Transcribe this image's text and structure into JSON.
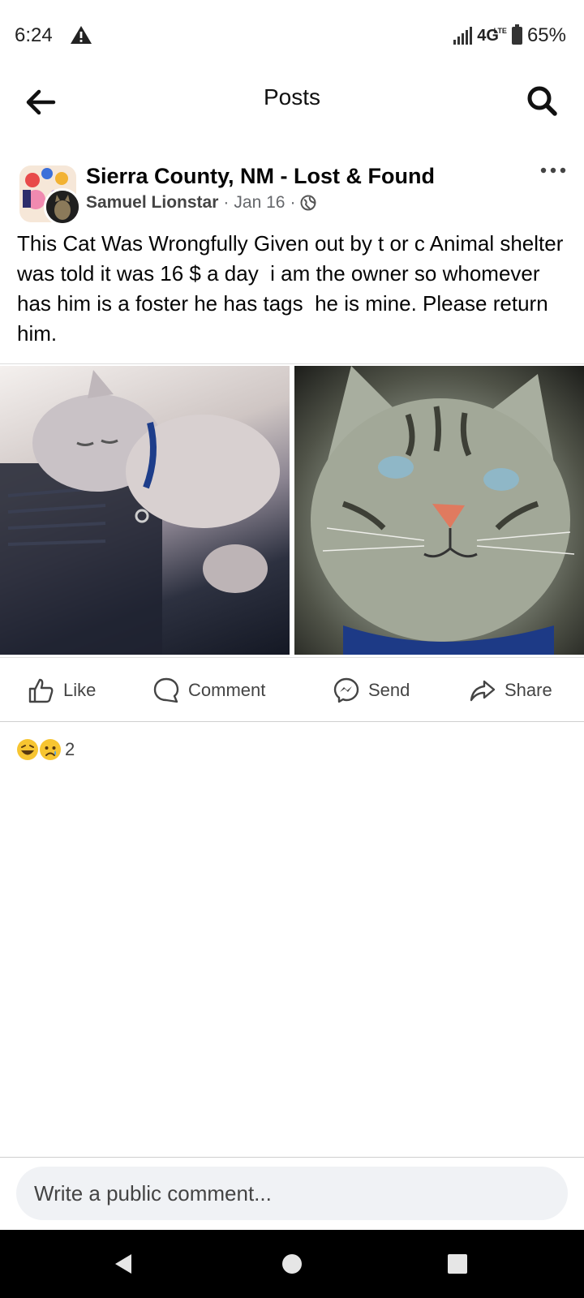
{
  "status_bar": {
    "time": "6:24",
    "network": "4G",
    "network_small": "LTE",
    "battery": "65%"
  },
  "header": {
    "title": "Posts"
  },
  "post": {
    "group_name": "Sierra County, NM - Lost & Found",
    "author": "Samuel Lionstar",
    "sep1": "·",
    "date": "Jan 16",
    "sep2": "·",
    "text": "This Cat Was Wrongfully Given out by t or c Animal shelter  was told it was 16 $ a day  i am the owner so whomever has him is a foster he has tags  he is mine. Please return him."
  },
  "actions": {
    "like": "Like",
    "comment": "Comment",
    "send": "Send",
    "share": "Share"
  },
  "reactions": {
    "icons": [
      "laughing-emoji",
      "sad-emoji"
    ],
    "count": "2"
  },
  "comment_input": {
    "placeholder": "Write a public comment..."
  },
  "colors": {
    "meta_gray": "#65676b",
    "input_bg": "#f0f2f5",
    "navbar": "#000000"
  }
}
